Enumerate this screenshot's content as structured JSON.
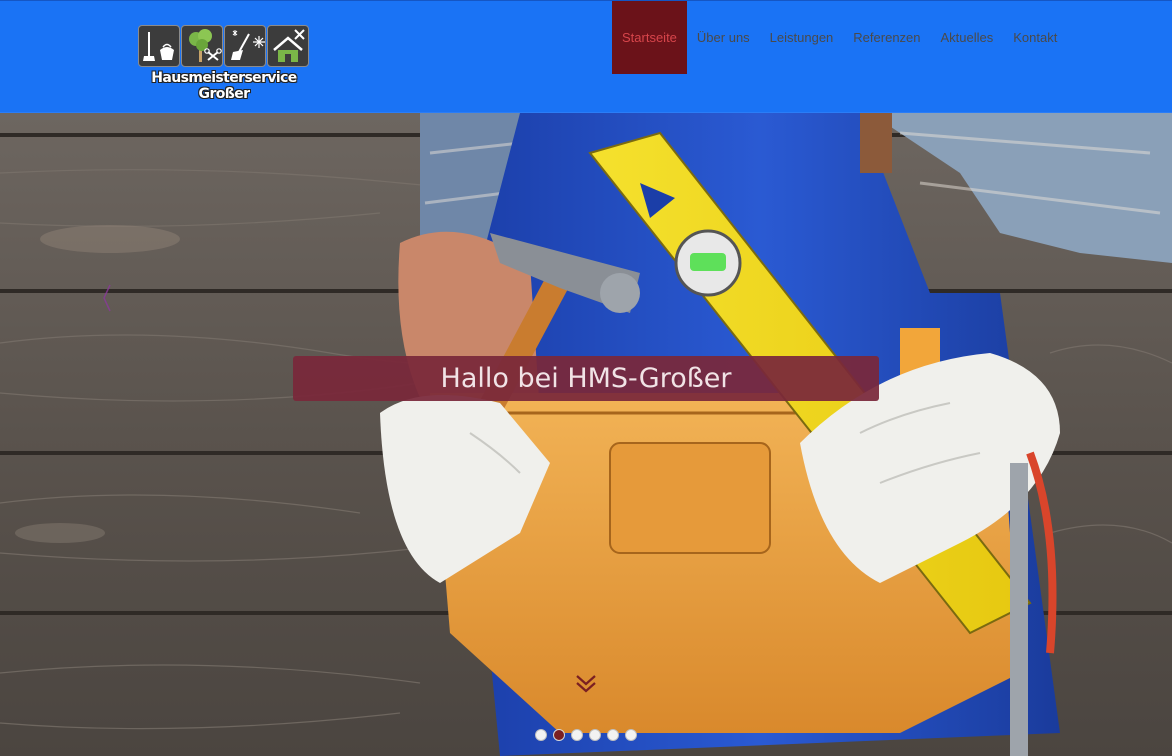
{
  "logo": {
    "line1": "Hausmeisterservice",
    "line2": "Großer",
    "icons": [
      "broom-bucket-icon",
      "tree-shears-icon",
      "shovel-snowflake-icon",
      "house-tools-icon"
    ]
  },
  "nav": {
    "items": [
      {
        "label": "Startseite",
        "active": true
      },
      {
        "label": "Über uns"
      },
      {
        "label": "Leistungen"
      },
      {
        "label": "Referenzen"
      },
      {
        "label": "Aktuelles"
      },
      {
        "label": "Kontakt"
      }
    ]
  },
  "hero": {
    "title": "Hallo bei HMS-Großer",
    "scroll_icon": "chevron-down-icon",
    "slides": 6,
    "active_slide": 2
  },
  "colors": {
    "header_bg": "#1a73f5",
    "nav_active_bg": "#6b1219",
    "nav_active_text": "#d7454b",
    "banner_bg": "#7a283a",
    "dot_active": "#7a1f22"
  }
}
